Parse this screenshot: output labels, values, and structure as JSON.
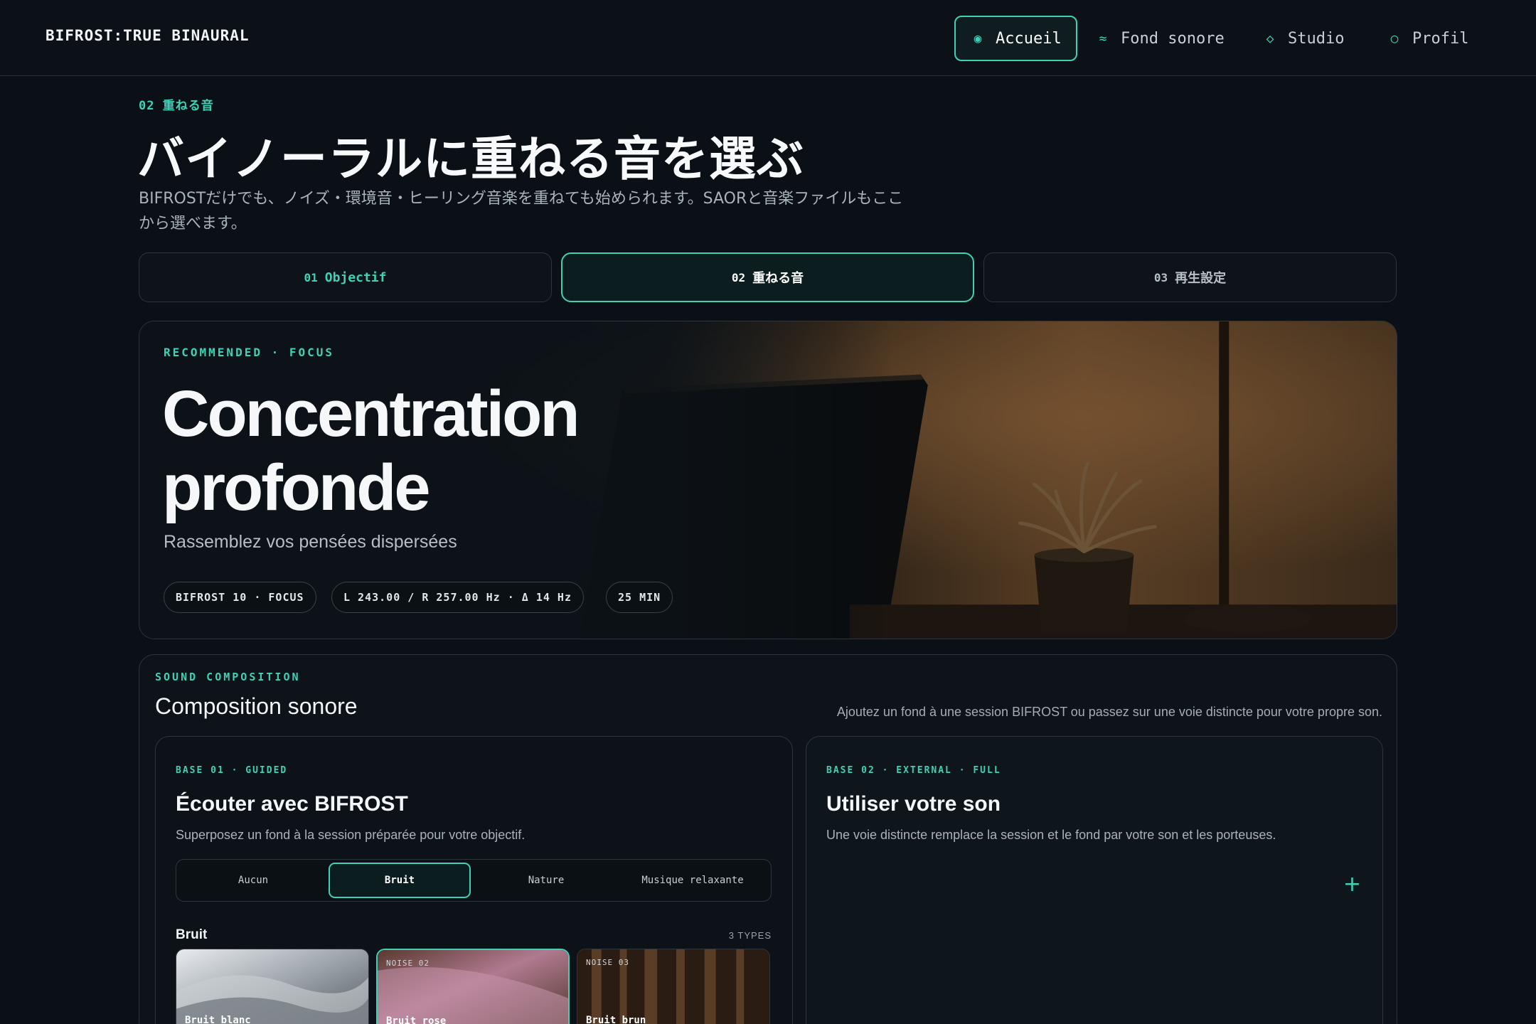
{
  "brand": "BIFROST:TRUE BINAURAL",
  "nav": [
    {
      "label": "Accueil",
      "icon": "dot-icon",
      "glyph": "◉"
    },
    {
      "label": "Fond sonore",
      "icon": "wave-icon",
      "glyph": "≈"
    },
    {
      "label": "Studio",
      "icon": "diamond-icon",
      "glyph": "◇"
    },
    {
      "label": "Profil",
      "icon": "circle-icon",
      "glyph": "○"
    }
  ],
  "header": {
    "eyebrow": "02 重ねる音",
    "title": "バイノーラルに重ねる音を選ぶ",
    "description": "BIFROSTだけでも、ノイズ・環境音・ヒーリング音楽を重ねても始められます。SAORと音楽ファイルもここから選べます。"
  },
  "steps": [
    {
      "num": "01",
      "label": "Objectif"
    },
    {
      "num": "02",
      "label": "重ねる音"
    },
    {
      "num": "03",
      "label": "再生設定"
    }
  ],
  "hero": {
    "eyebrow": "RECOMMENDED · FOCUS",
    "title": "Concentration profonde",
    "subtitle": "Rassemblez vos pensées dispersées",
    "chips": [
      "BIFROST 10 · FOCUS",
      "L 243.00 / R 257.00 Hz · Δ 14 Hz",
      "25 MIN"
    ]
  },
  "composition": {
    "eyebrow": "SOUND COMPOSITION",
    "title": "Composition sonore",
    "description": "Ajoutez un fond à une session BIFROST ou passez sur une voie distincte pour votre propre son.",
    "guided": {
      "eyebrow": "BASE 01 · GUIDED",
      "title": "Écouter avec BIFROST",
      "description": "Superposez un fond à la session préparée pour votre objectif.",
      "options": [
        "Aucun",
        "Bruit",
        "Nature",
        "Musique relaxante"
      ],
      "selected_option": "Bruit",
      "group_label": "Bruit",
      "group_count": "3 TYPES",
      "tiles": [
        {
          "code": "",
          "name": "Bruit blanc"
        },
        {
          "code": "NOISE 02",
          "name": "Bruit rose"
        },
        {
          "code": "NOISE 03",
          "name": "Bruit brun"
        }
      ]
    },
    "external": {
      "eyebrow": "BASE 02 · EXTERNAL · FULL",
      "title": "Utiliser votre son",
      "description": "Une voie distincte remplace la session et le fond par votre son et les porteuses.",
      "add_glyph": "+"
    }
  },
  "colors": {
    "accent": "#3fd1b6",
    "background": "#0b1016"
  }
}
